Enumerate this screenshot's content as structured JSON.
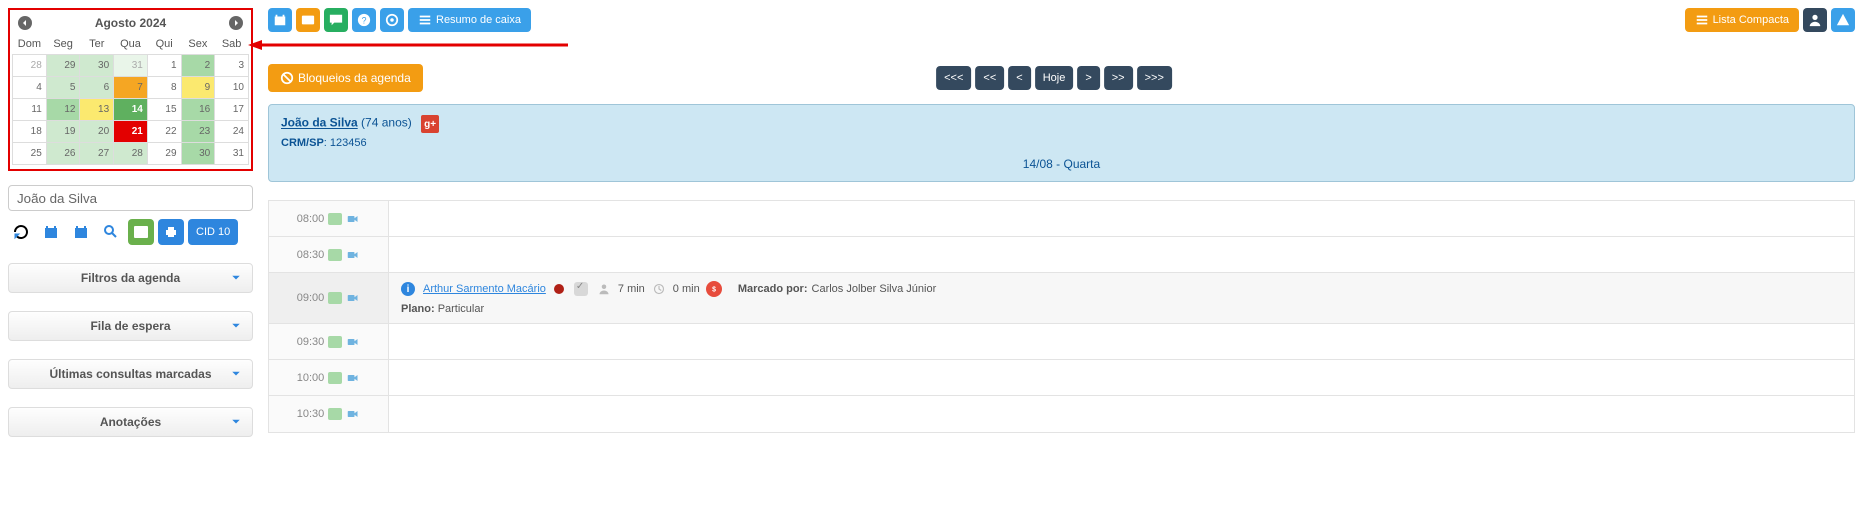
{
  "calendar": {
    "title": "Agosto 2024",
    "weekdays": [
      "Dom",
      "Seg",
      "Ter",
      "Qua",
      "Qui",
      "Sex",
      "Sab"
    ],
    "weeks": [
      [
        {
          "n": 28,
          "c": "muted"
        },
        {
          "n": 29,
          "c": "g2"
        },
        {
          "n": 30,
          "c": "g2"
        },
        {
          "n": 31,
          "c": "muted g1"
        },
        {
          "n": 1,
          "c": ""
        },
        {
          "n": 2,
          "c": "g3"
        },
        {
          "n": 3,
          "c": ""
        }
      ],
      [
        {
          "n": 4,
          "c": ""
        },
        {
          "n": 5,
          "c": "g2"
        },
        {
          "n": 6,
          "c": "g2"
        },
        {
          "n": 7,
          "c": "oran"
        },
        {
          "n": 8,
          "c": ""
        },
        {
          "n": 9,
          "c": "yel"
        },
        {
          "n": 10,
          "c": ""
        }
      ],
      [
        {
          "n": 11,
          "c": ""
        },
        {
          "n": 12,
          "c": "g3"
        },
        {
          "n": 13,
          "c": "yel"
        },
        {
          "n": 14,
          "c": "today"
        },
        {
          "n": 15,
          "c": ""
        },
        {
          "n": 16,
          "c": "g3"
        },
        {
          "n": 17,
          "c": ""
        }
      ],
      [
        {
          "n": 18,
          "c": ""
        },
        {
          "n": 19,
          "c": "g2"
        },
        {
          "n": 20,
          "c": "g2"
        },
        {
          "n": 21,
          "c": "red"
        },
        {
          "n": 22,
          "c": ""
        },
        {
          "n": 23,
          "c": "g3"
        },
        {
          "n": 24,
          "c": ""
        }
      ],
      [
        {
          "n": 25,
          "c": ""
        },
        {
          "n": 26,
          "c": "g2"
        },
        {
          "n": 27,
          "c": "g2"
        },
        {
          "n": 28,
          "c": "g2"
        },
        {
          "n": 29,
          "c": ""
        },
        {
          "n": 30,
          "c": "g3"
        },
        {
          "n": 31,
          "c": ""
        }
      ]
    ]
  },
  "sidebar": {
    "name_input": "João da Silva",
    "cid_label": "CID 10",
    "accordions": [
      "Filtros da agenda",
      "Fila de espera",
      "Últimas consultas marcadas",
      "Anotações"
    ]
  },
  "top": {
    "resumo": "Resumo de caixa",
    "lista": "Lista Compacta"
  },
  "blocks": {
    "label": "Bloqueios da agenda"
  },
  "date_nav": {
    "first": "<<<",
    "prev2": "<<",
    "prev": "<",
    "today": "Hoje",
    "next": ">",
    "next2": ">>",
    "last": ">>>"
  },
  "doctor": {
    "name": "João da Silva",
    "age": "(74 anos)",
    "crm_label": "CRM/SP",
    "crm_value": ": 123456",
    "date": "14/08 - Quarta"
  },
  "schedule": {
    "slots": [
      {
        "time": "08:00"
      },
      {
        "time": "08:30"
      },
      {
        "time": "09:00",
        "appt": {
          "patient": "Arthur Sarmento Macário",
          "wait": "7 min",
          "att": "0 min",
          "marked_by_label": "Marcado por:",
          "marked_by": "Carlos Jolber Silva Júnior",
          "plan_label": "Plano:",
          "plan": "Particular"
        }
      },
      {
        "time": "09:30"
      },
      {
        "time": "10:00"
      },
      {
        "time": "10:30"
      }
    ]
  }
}
